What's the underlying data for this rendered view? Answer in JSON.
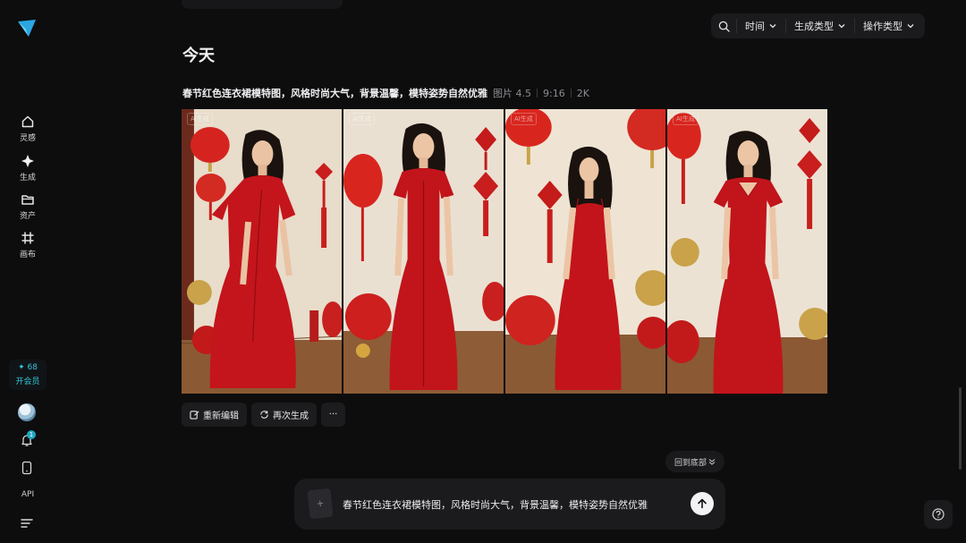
{
  "sidebar": {
    "items": [
      {
        "label": "灵感",
        "icon": "home-icon"
      },
      {
        "label": "生成",
        "icon": "sparkle-icon"
      },
      {
        "label": "资产",
        "icon": "folder-icon"
      },
      {
        "label": "画布",
        "icon": "canvas-icon"
      }
    ],
    "credits": "✦ 68",
    "vip_label": "开会员",
    "notification_count": "1",
    "api_label": "API"
  },
  "filters": {
    "time": "时间",
    "gen_type": "生成类型",
    "op_type": "操作类型"
  },
  "section_title": "今天",
  "result": {
    "prompt": "春节红色连衣裙模特图，风格时尚大气，背景温馨，模特姿势自然优雅",
    "model": "图片 4.5",
    "ratio": "9:16",
    "resolution": "2K",
    "ai_tag": "AI生成"
  },
  "actions": {
    "re_edit": "重新编辑",
    "regenerate": "再次生成",
    "more": "···"
  },
  "back_to_bottom": "回到底部",
  "composer": {
    "text": "春节红色连衣裙模特图，风格时尚大气，背景温馨，模特姿势自然优雅",
    "attach_glyph": "+"
  },
  "colors": {
    "accent": "#33c6d9",
    "background": "#0d0d0e",
    "dress_red": "#c4151c"
  }
}
